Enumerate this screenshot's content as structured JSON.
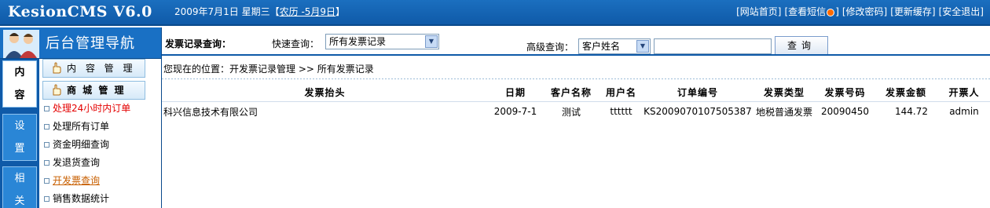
{
  "header": {
    "brand": "KesionCMS V6.0",
    "date": "2009年7月1日 星期三【",
    "lunar": "农历 -5月9日",
    "date_end": "】",
    "links": [
      "[网站首页]",
      "[查看短信",
      "]",
      "[修改密码]",
      "[更新缓存]",
      "[安全退出]"
    ],
    "msg_count": "0"
  },
  "sidebar": {
    "title": "后台管理导航",
    "tabs": [
      {
        "line1": "内",
        "line2": "容"
      },
      {
        "line1": "设",
        "line2": "置"
      },
      {
        "line1": "相",
        "line2": "关"
      }
    ],
    "buttons": [
      "内 容 管 理",
      "商 城 管 理"
    ],
    "items": [
      "处理24小时内订单",
      "处理所有订单",
      "资金明细查询",
      "发退货查询",
      "开发票查询",
      "销售数据统计"
    ]
  },
  "query": {
    "title": "发票记录查询：",
    "quick_label": "快速查询：",
    "quick_value": "所有发票记录",
    "adv_label": "高级查询：",
    "adv_value": "客户姓名",
    "search_value": "",
    "button": "查询"
  },
  "breadcrumb": "您现在的位置：开发票记录管理 >>  所有发票记录",
  "table": {
    "headers": [
      "发票抬头",
      "日期",
      "客户名称",
      "用户名",
      "订单编号",
      "发票类型",
      "发票号码",
      "发票金额",
      "开票人"
    ],
    "rows": [
      [
        "科兴信息技术有限公司",
        "2009-7-1",
        "测试",
        "tttttt",
        "KS2009070107505387",
        "地税普通发票",
        "20090450",
        "144.72",
        "admin"
      ]
    ]
  },
  "colors": {
    "header_bg": "#0f5aa8",
    "accent": "#1970c4",
    "alert_text": "#e40000",
    "active_link": "#c85f00"
  }
}
